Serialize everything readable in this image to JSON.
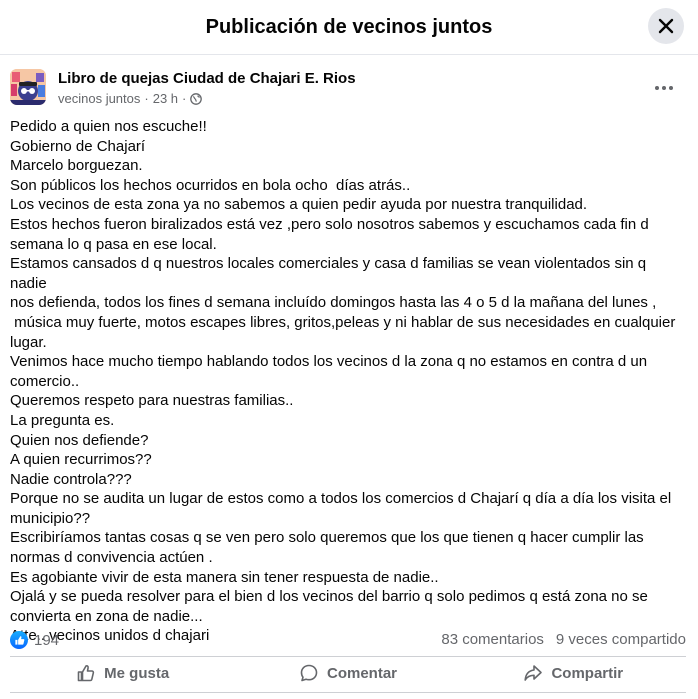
{
  "modal": {
    "title": "Publicación de vecinos juntos"
  },
  "post": {
    "author": "Libro de quejas Ciudad de Chajari E. Rios",
    "group": "vecinos juntos",
    "separator": "·",
    "time": "23 h",
    "separator2": "·",
    "privacy_icon": "globe-icon",
    "body_lines": [
      "Pedido a quien nos escuche!!",
      "Gobierno de Chajarí",
      "Marcelo borguezan.",
      "Son públicos los hechos ocurridos en bola ocho  días atrás..",
      "Los vecinos de esta zona ya no sabemos a quien pedir ayuda por nuestra tranquilidad.",
      "Estos hechos fueron biralizados está vez ,pero solo nosotros sabemos y escuchamos cada fin d",
      "semana lo q pasa en ese local.",
      "Estamos cansados d q nuestros locales comerciales y casa d familias se vean violentados sin q nadie",
      "nos defienda, todos los fines d semana incluído domingos hasta las 4 o 5 d la mañana del lunes ,",
      " música muy fuerte, motos escapes libres, gritos,peleas y ni hablar de sus necesidades en cualquier",
      "lugar.",
      "Venimos hace mucho tiempo hablando todos los vecinos d la zona q no estamos en contra d un",
      "comercio..",
      "Queremos respeto para nuestras familias..",
      "La pregunta es.",
      "Quien nos defiende?",
      "A quien recurrimos??",
      "Nadie controla???",
      "Porque no se audita un lugar de estos como a todos los comercios d Chajarí q día a día los visita el",
      "municipio??",
      "Escribiríamos tantas cosas q se ven pero solo queremos que los que tienen q hacer cumplir las",
      "normas d convivencia actúen .",
      "Es agobiante vivir de esta manera sin tener respuesta de nadie..",
      "Ojalá y se pueda resolver para el bien d los vecinos del barrio q solo pedimos q está zona no se",
      "convierta en zona de nadie...",
      "Atte.. vecinos unidos d chajari"
    ]
  },
  "stats": {
    "reaction_count": "194",
    "comments": "83 comentarios",
    "shares": "9 veces compartido"
  },
  "actions": {
    "like": "Me gusta",
    "comment": "Comentar",
    "share": "Compartir"
  },
  "colors": {
    "accent": "#0866ff",
    "secondary_text": "#65676b",
    "divider": "#ced0d4"
  }
}
